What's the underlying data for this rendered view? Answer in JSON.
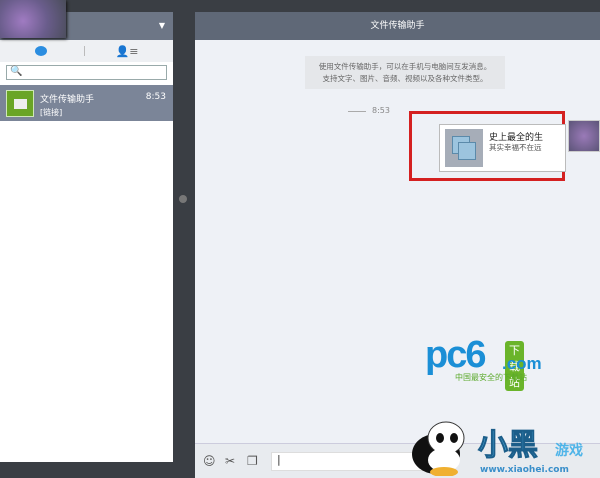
{
  "left": {
    "caret": "▼",
    "contacts_icon": "👤≡",
    "search_icon": "🔍",
    "conversation": {
      "name": "文件传输助手",
      "time": "8:53",
      "preview": "[链接]"
    }
  },
  "chat": {
    "title": "文件传输助手",
    "notice_line1": "使用文件传输助手，可以在手机与电脑间互发消息。",
    "notice_line2": "支持文字、图片、音频、视频以及各种文件类型。",
    "timestamp": "8:53",
    "card_title": "史上最全的生",
    "card_subtitle": "其实幸福不在远"
  },
  "toolbar": {
    "emoji_icon": "☺",
    "screenshot_icon": "✂",
    "copy_icon": "❐",
    "input_value": "|"
  },
  "watermarks": {
    "pc6": "pc6",
    "pc6_badge": "下载站",
    "pc6_domain": ".com",
    "pc6_slogan": "中国最安全的下载站",
    "xh_1": "小黑",
    "xh_2": "游戏",
    "xh_url": "www.xiaohei.com"
  }
}
